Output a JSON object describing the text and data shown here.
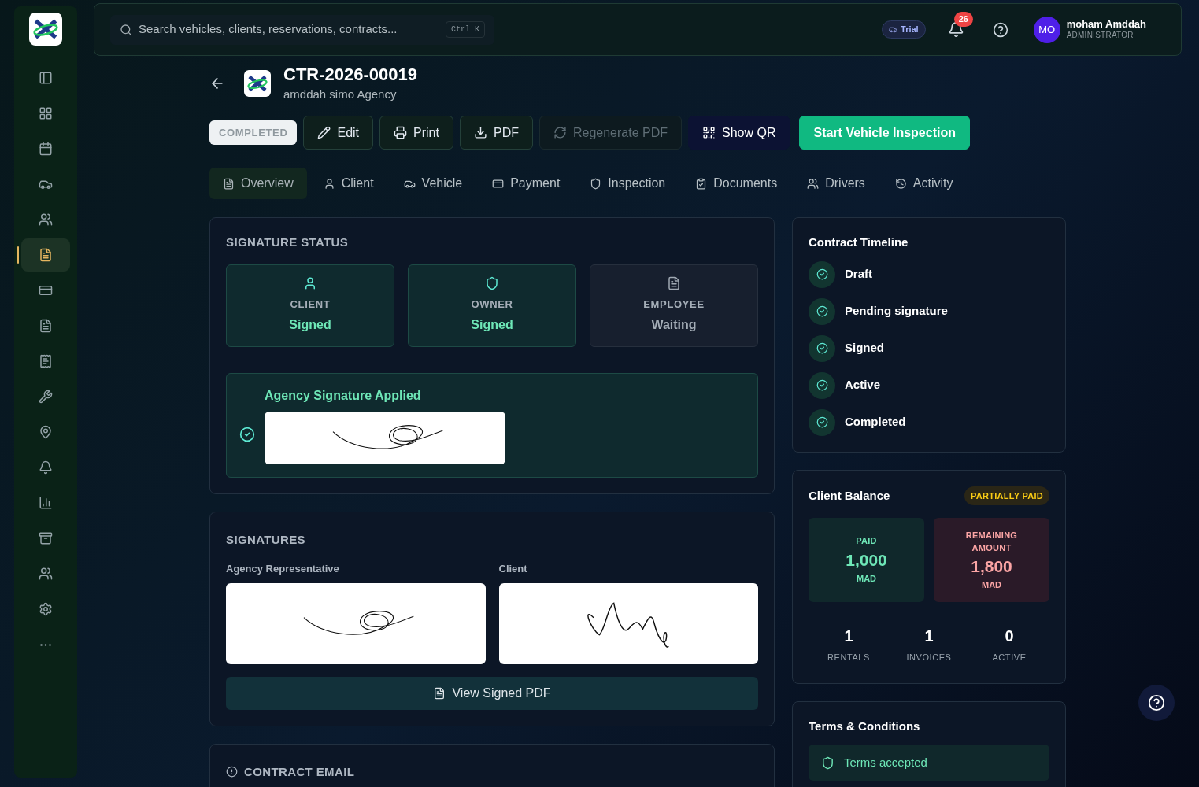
{
  "sidebar": {
    "items": [
      {
        "selected": false
      },
      {
        "selected": false
      },
      {
        "selected": false
      },
      {
        "selected": false
      },
      {
        "selected": false
      },
      {
        "selected": true
      },
      {
        "selected": false
      },
      {
        "selected": false
      },
      {
        "selected": false
      },
      {
        "selected": false
      },
      {
        "selected": false
      },
      {
        "selected": false
      },
      {
        "selected": false
      },
      {
        "selected": false
      },
      {
        "selected": false
      },
      {
        "selected": false
      },
      {
        "selected": false
      }
    ]
  },
  "header": {
    "search": {
      "placeholder": "Search vehicles, clients, reservations, contracts...",
      "shortcut": "Ctrl K"
    },
    "plan_badge": "Trial",
    "notifications": "26",
    "user": {
      "initials": "MO",
      "name": "moham Amddah",
      "role": "ADMINISTRATOR"
    }
  },
  "contract": {
    "number": "CTR-2026-00019",
    "agency": "amddah simo Agency",
    "status": "COMPLETED"
  },
  "actions": [
    {
      "label": "Edit",
      "kind": "outline",
      "disabled": false
    },
    {
      "label": "Print",
      "kind": "outline",
      "disabled": false
    },
    {
      "label": "PDF",
      "kind": "outline",
      "disabled": false
    },
    {
      "label": "Regenerate PDF",
      "kind": "outline",
      "disabled": true
    },
    {
      "label": "Show QR",
      "kind": "dark",
      "disabled": false
    },
    {
      "label": "Start Vehicle Inspection",
      "kind": "primary",
      "disabled": false
    }
  ],
  "tabs": [
    {
      "label": "Overview",
      "selected": true
    },
    {
      "label": "Client",
      "selected": false
    },
    {
      "label": "Vehicle",
      "selected": false
    },
    {
      "label": "Payment",
      "selected": false
    },
    {
      "label": "Inspection",
      "selected": false
    },
    {
      "label": "Documents",
      "selected": false
    },
    {
      "label": "Drivers",
      "selected": false
    },
    {
      "label": "Activity",
      "selected": false
    }
  ],
  "signature_status": {
    "title": "SIGNATURE STATUS",
    "parties": [
      {
        "role": "CLIENT",
        "status": "Signed",
        "signed": true
      },
      {
        "role": "OWNER",
        "status": "Signed",
        "signed": true
      },
      {
        "role": "EMPLOYEE",
        "status": "Waiting",
        "signed": false
      }
    ],
    "agency_signature": "Agency Signature Applied"
  },
  "signatures": {
    "title": "SIGNATURES",
    "items": [
      {
        "label": "Agency Representative"
      },
      {
        "label": "Client"
      }
    ],
    "view_button": "View Signed PDF"
  },
  "contract_email": {
    "title": "CONTRACT EMAIL"
  },
  "timeline": {
    "title": "Contract Timeline",
    "steps": [
      {
        "label": "Draft",
        "done": true
      },
      {
        "label": "Pending signature",
        "done": true
      },
      {
        "label": "Signed",
        "done": true
      },
      {
        "label": "Active",
        "done": true
      },
      {
        "label": "Completed",
        "done": true
      }
    ]
  },
  "client_balance": {
    "title": "Client Balance",
    "badge": "PARTIALLY PAID",
    "paid": {
      "label": "PAID",
      "amount": "1,000",
      "currency": "MAD"
    },
    "remaining": {
      "label": "REMAINING AMOUNT",
      "amount": "1,800",
      "currency": "MAD"
    },
    "stats": [
      {
        "value": "1",
        "label": "RENTALS"
      },
      {
        "value": "1",
        "label": "INVOICES"
      },
      {
        "value": "0",
        "label": "ACTIVE"
      }
    ]
  },
  "terms": {
    "title": "Terms & Conditions",
    "accepted": true,
    "label": "Terms accepted"
  }
}
